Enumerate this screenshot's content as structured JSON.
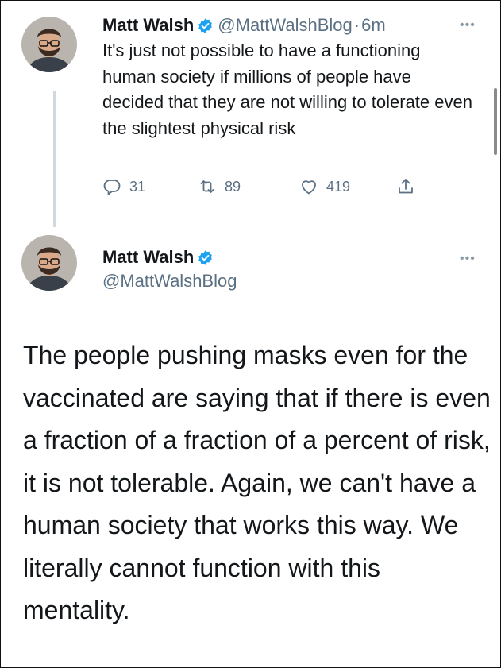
{
  "tweet1": {
    "author_name": "Matt Walsh",
    "handle": "@MattWalshBlog",
    "separator": "·",
    "time": "6m",
    "text": "It's just not possible to have a functioning human society if millions of people have decided that they are not willing to tolerate even the slightest physical risk",
    "replies": "31",
    "retweets": "89",
    "likes": "419",
    "more": "•••"
  },
  "tweet2": {
    "author_name": "Matt Walsh",
    "handle": "@MattWalshBlog",
    "text": "The people pushing masks even for the vaccinated are saying that if there is even a fraction of a fraction of a percent of risk, it is not tolerable. Again, we can't have a human society that works this way. We literally cannot function with this mentality.",
    "more": "•••"
  },
  "colors": {
    "verified": "#1da1f2",
    "secondary_text": "#5b7083",
    "primary_text": "#14171a",
    "thread_line": "#cfd9de"
  },
  "icons": [
    "verified-badge-icon",
    "reply-icon",
    "retweet-icon",
    "like-icon",
    "share-icon",
    "more-icon"
  ]
}
